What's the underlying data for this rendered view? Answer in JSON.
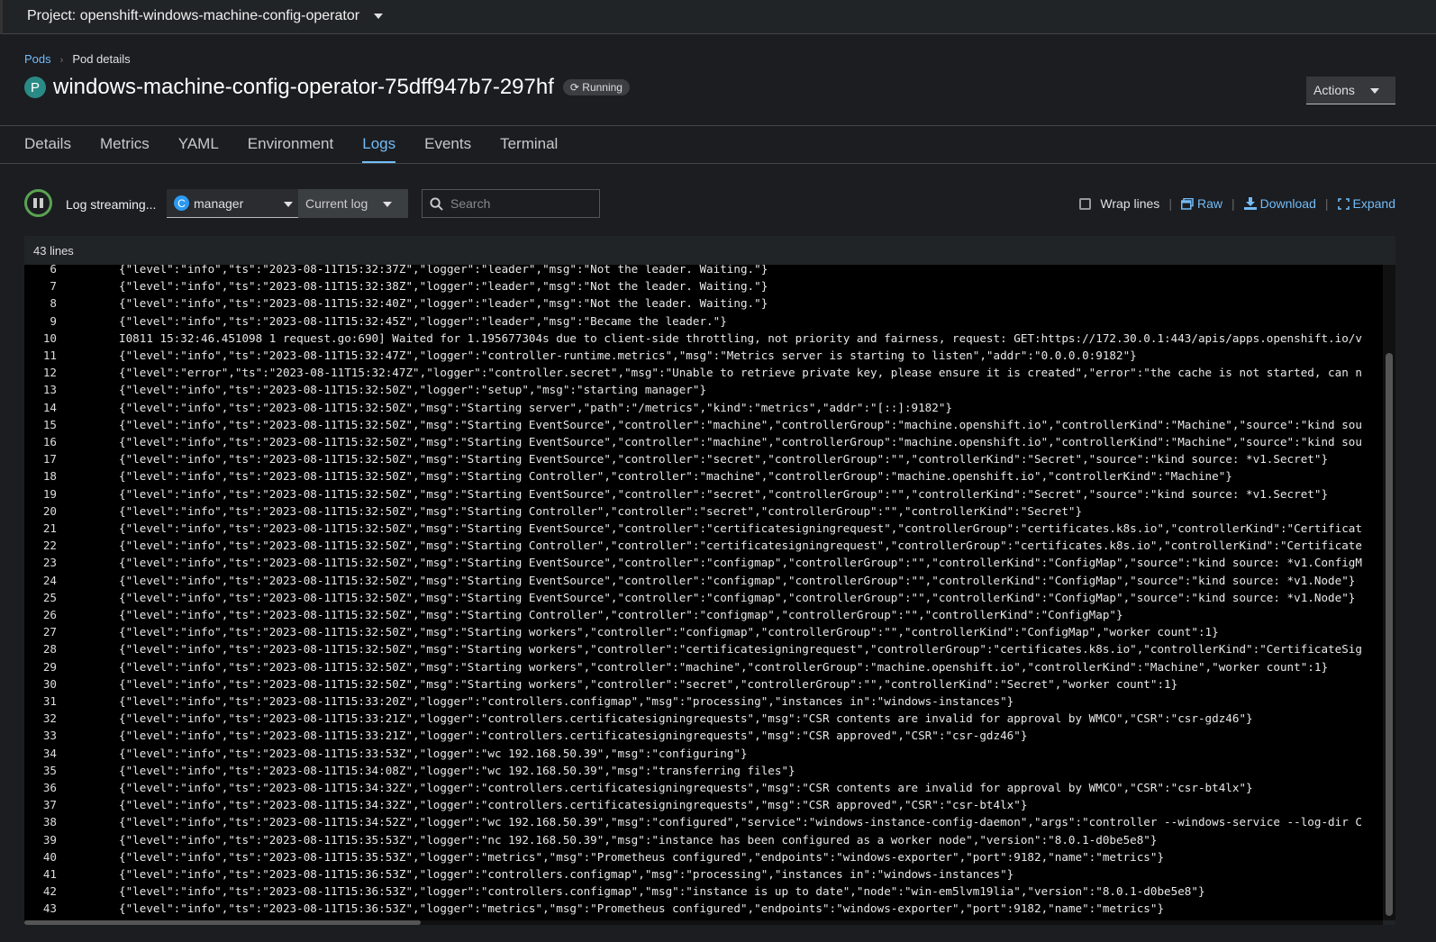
{
  "project": {
    "label": "Project: openshift-windows-machine-config-operator"
  },
  "breadcrumb": {
    "pods": "Pods",
    "current": "Pod details"
  },
  "pod": {
    "badge": "P",
    "name": "windows-machine-config-operator-75dff947b7-297hf",
    "status": "Running"
  },
  "actions": {
    "label": "Actions"
  },
  "tabs": [
    "Details",
    "Metrics",
    "YAML",
    "Environment",
    "Logs",
    "Events",
    "Terminal"
  ],
  "toolbar": {
    "streaming": "Log streaming...",
    "container_badge": "C",
    "container": "manager",
    "log_select": "Current log",
    "search_placeholder": "Search",
    "wrap_lines": "Wrap lines",
    "raw": "Raw",
    "download": "Download",
    "expand": "Expand"
  },
  "log": {
    "count": "43 lines",
    "lines": [
      {
        "n": "6",
        "t": "{\"level\":\"info\",\"ts\":\"2023-08-11T15:32:37Z\",\"logger\":\"leader\",\"msg\":\"Not the leader. Waiting.\"}"
      },
      {
        "n": "7",
        "t": "{\"level\":\"info\",\"ts\":\"2023-08-11T15:32:38Z\",\"logger\":\"leader\",\"msg\":\"Not the leader. Waiting.\"}"
      },
      {
        "n": "8",
        "t": "{\"level\":\"info\",\"ts\":\"2023-08-11T15:32:40Z\",\"logger\":\"leader\",\"msg\":\"Not the leader. Waiting.\"}"
      },
      {
        "n": "9",
        "t": "{\"level\":\"info\",\"ts\":\"2023-08-11T15:32:45Z\",\"logger\":\"leader\",\"msg\":\"Became the leader.\"}"
      },
      {
        "n": "10",
        "t": "I0811 15:32:46.451098 1 request.go:690] Waited for 1.195677304s due to client-side throttling, not priority and fairness, request: GET:https://172.30.0.1:443/apis/apps.openshift.io/v"
      },
      {
        "n": "11",
        "t": "{\"level\":\"info\",\"ts\":\"2023-08-11T15:32:47Z\",\"logger\":\"controller-runtime.metrics\",\"msg\":\"Metrics server is starting to listen\",\"addr\":\"0.0.0.0:9182\"}"
      },
      {
        "n": "12",
        "t": "{\"level\":\"error\",\"ts\":\"2023-08-11T15:32:47Z\",\"logger\":\"controller.secret\",\"msg\":\"Unable to retrieve private key, please ensure it is created\",\"error\":\"the cache is not started, can n"
      },
      {
        "n": "13",
        "t": "{\"level\":\"info\",\"ts\":\"2023-08-11T15:32:50Z\",\"logger\":\"setup\",\"msg\":\"starting manager\"}"
      },
      {
        "n": "14",
        "t": "{\"level\":\"info\",\"ts\":\"2023-08-11T15:32:50Z\",\"msg\":\"Starting server\",\"path\":\"/metrics\",\"kind\":\"metrics\",\"addr\":\"[::]:9182\"}"
      },
      {
        "n": "15",
        "t": "{\"level\":\"info\",\"ts\":\"2023-08-11T15:32:50Z\",\"msg\":\"Starting EventSource\",\"controller\":\"machine\",\"controllerGroup\":\"machine.openshift.io\",\"controllerKind\":\"Machine\",\"source\":\"kind sou"
      },
      {
        "n": "16",
        "t": "{\"level\":\"info\",\"ts\":\"2023-08-11T15:32:50Z\",\"msg\":\"Starting EventSource\",\"controller\":\"machine\",\"controllerGroup\":\"machine.openshift.io\",\"controllerKind\":\"Machine\",\"source\":\"kind sou"
      },
      {
        "n": "17",
        "t": "{\"level\":\"info\",\"ts\":\"2023-08-11T15:32:50Z\",\"msg\":\"Starting EventSource\",\"controller\":\"secret\",\"controllerGroup\":\"\",\"controllerKind\":\"Secret\",\"source\":\"kind source: *v1.Secret\"}"
      },
      {
        "n": "18",
        "t": "{\"level\":\"info\",\"ts\":\"2023-08-11T15:32:50Z\",\"msg\":\"Starting Controller\",\"controller\":\"machine\",\"controllerGroup\":\"machine.openshift.io\",\"controllerKind\":\"Machine\"}"
      },
      {
        "n": "19",
        "t": "{\"level\":\"info\",\"ts\":\"2023-08-11T15:32:50Z\",\"msg\":\"Starting EventSource\",\"controller\":\"secret\",\"controllerGroup\":\"\",\"controllerKind\":\"Secret\",\"source\":\"kind source: *v1.Secret\"}"
      },
      {
        "n": "20",
        "t": "{\"level\":\"info\",\"ts\":\"2023-08-11T15:32:50Z\",\"msg\":\"Starting Controller\",\"controller\":\"secret\",\"controllerGroup\":\"\",\"controllerKind\":\"Secret\"}"
      },
      {
        "n": "21",
        "t": "{\"level\":\"info\",\"ts\":\"2023-08-11T15:32:50Z\",\"msg\":\"Starting EventSource\",\"controller\":\"certificatesigningrequest\",\"controllerGroup\":\"certificates.k8s.io\",\"controllerKind\":\"Certificat"
      },
      {
        "n": "22",
        "t": "{\"level\":\"info\",\"ts\":\"2023-08-11T15:32:50Z\",\"msg\":\"Starting Controller\",\"controller\":\"certificatesigningrequest\",\"controllerGroup\":\"certificates.k8s.io\",\"controllerKind\":\"Certificate"
      },
      {
        "n": "23",
        "t": "{\"level\":\"info\",\"ts\":\"2023-08-11T15:32:50Z\",\"msg\":\"Starting EventSource\",\"controller\":\"configmap\",\"controllerGroup\":\"\",\"controllerKind\":\"ConfigMap\",\"source\":\"kind source: *v1.ConfigM"
      },
      {
        "n": "24",
        "t": "{\"level\":\"info\",\"ts\":\"2023-08-11T15:32:50Z\",\"msg\":\"Starting EventSource\",\"controller\":\"configmap\",\"controllerGroup\":\"\",\"controllerKind\":\"ConfigMap\",\"source\":\"kind source: *v1.Node\"}"
      },
      {
        "n": "25",
        "t": "{\"level\":\"info\",\"ts\":\"2023-08-11T15:32:50Z\",\"msg\":\"Starting EventSource\",\"controller\":\"configmap\",\"controllerGroup\":\"\",\"controllerKind\":\"ConfigMap\",\"source\":\"kind source: *v1.Node\"}"
      },
      {
        "n": "26",
        "t": "{\"level\":\"info\",\"ts\":\"2023-08-11T15:32:50Z\",\"msg\":\"Starting Controller\",\"controller\":\"configmap\",\"controllerGroup\":\"\",\"controllerKind\":\"ConfigMap\"}"
      },
      {
        "n": "27",
        "t": "{\"level\":\"info\",\"ts\":\"2023-08-11T15:32:50Z\",\"msg\":\"Starting workers\",\"controller\":\"configmap\",\"controllerGroup\":\"\",\"controllerKind\":\"ConfigMap\",\"worker count\":1}"
      },
      {
        "n": "28",
        "t": "{\"level\":\"info\",\"ts\":\"2023-08-11T15:32:50Z\",\"msg\":\"Starting workers\",\"controller\":\"certificatesigningrequest\",\"controllerGroup\":\"certificates.k8s.io\",\"controllerKind\":\"CertificateSig"
      },
      {
        "n": "29",
        "t": "{\"level\":\"info\",\"ts\":\"2023-08-11T15:32:50Z\",\"msg\":\"Starting workers\",\"controller\":\"machine\",\"controllerGroup\":\"machine.openshift.io\",\"controllerKind\":\"Machine\",\"worker count\":1}"
      },
      {
        "n": "30",
        "t": "{\"level\":\"info\",\"ts\":\"2023-08-11T15:32:50Z\",\"msg\":\"Starting workers\",\"controller\":\"secret\",\"controllerGroup\":\"\",\"controllerKind\":\"Secret\",\"worker count\":1}"
      },
      {
        "n": "31",
        "t": "{\"level\":\"info\",\"ts\":\"2023-08-11T15:33:20Z\",\"logger\":\"controllers.configmap\",\"msg\":\"processing\",\"instances in\":\"windows-instances\"}"
      },
      {
        "n": "32",
        "t": "{\"level\":\"info\",\"ts\":\"2023-08-11T15:33:21Z\",\"logger\":\"controllers.certificatesigningrequests\",\"msg\":\"CSR contents are invalid for approval by WMCO\",\"CSR\":\"csr-gdz46\"}"
      },
      {
        "n": "33",
        "t": "{\"level\":\"info\",\"ts\":\"2023-08-11T15:33:21Z\",\"logger\":\"controllers.certificatesigningrequests\",\"msg\":\"CSR approved\",\"CSR\":\"csr-gdz46\"}"
      },
      {
        "n": "34",
        "t": "{\"level\":\"info\",\"ts\":\"2023-08-11T15:33:53Z\",\"logger\":\"wc 192.168.50.39\",\"msg\":\"configuring\"}"
      },
      {
        "n": "35",
        "t": "{\"level\":\"info\",\"ts\":\"2023-08-11T15:34:08Z\",\"logger\":\"wc 192.168.50.39\",\"msg\":\"transferring files\"}"
      },
      {
        "n": "36",
        "t": "{\"level\":\"info\",\"ts\":\"2023-08-11T15:34:32Z\",\"logger\":\"controllers.certificatesigningrequests\",\"msg\":\"CSR contents are invalid for approval by WMCO\",\"CSR\":\"csr-bt4lx\"}"
      },
      {
        "n": "37",
        "t": "{\"level\":\"info\",\"ts\":\"2023-08-11T15:34:32Z\",\"logger\":\"controllers.certificatesigningrequests\",\"msg\":\"CSR approved\",\"CSR\":\"csr-bt4lx\"}"
      },
      {
        "n": "38",
        "t": "{\"level\":\"info\",\"ts\":\"2023-08-11T15:34:52Z\",\"logger\":\"wc 192.168.50.39\",\"msg\":\"configured\",\"service\":\"windows-instance-config-daemon\",\"args\":\"controller --windows-service --log-dir C"
      },
      {
        "n": "39",
        "t": "{\"level\":\"info\",\"ts\":\"2023-08-11T15:35:53Z\",\"logger\":\"nc 192.168.50.39\",\"msg\":\"instance has been configured as a worker node\",\"version\":\"8.0.1-d0be5e8\"}"
      },
      {
        "n": "40",
        "t": "{\"level\":\"info\",\"ts\":\"2023-08-11T15:35:53Z\",\"logger\":\"metrics\",\"msg\":\"Prometheus configured\",\"endpoints\":\"windows-exporter\",\"port\":9182,\"name\":\"metrics\"}"
      },
      {
        "n": "41",
        "t": "{\"level\":\"info\",\"ts\":\"2023-08-11T15:36:53Z\",\"logger\":\"controllers.configmap\",\"msg\":\"processing\",\"instances in\":\"windows-instances\"}"
      },
      {
        "n": "42",
        "t": "{\"level\":\"info\",\"ts\":\"2023-08-11T15:36:53Z\",\"logger\":\"controllers.configmap\",\"msg\":\"instance is up to date\",\"node\":\"win-em5lvm19lia\",\"version\":\"8.0.1-d0be5e8\"}"
      },
      {
        "n": "43",
        "t": "{\"level\":\"info\",\"ts\":\"2023-08-11T15:36:53Z\",\"logger\":\"metrics\",\"msg\":\"Prometheus configured\",\"endpoints\":\"windows-exporter\",\"port\":9182,\"name\":\"metrics\"}"
      }
    ]
  },
  "colors": {
    "accent": "#73bcf7",
    "streaming": "#5ba352",
    "pod_badge": "#2a8a85"
  }
}
